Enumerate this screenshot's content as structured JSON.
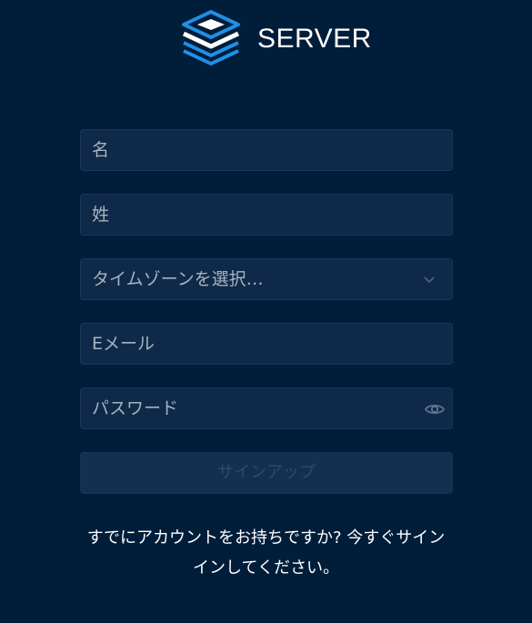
{
  "brand": {
    "name": "SERVER",
    "logo_icon": "layered-stack-icon",
    "logo_color": "#1e90e6"
  },
  "form": {
    "first_name_placeholder": "名",
    "last_name_placeholder": "姓",
    "timezone_selected": "タイムゾーンを選択…",
    "email_placeholder": "Eメール",
    "password_placeholder": "パスワード",
    "password_toggle_icon": "eye-icon",
    "timezone_dropdown_icon": "chevron-down-icon",
    "submit_label": "サインアップ"
  },
  "footer": {
    "signin_prompt": "すでにアカウントをお持ちですか? 今すぐサインインしてください。"
  },
  "colors": {
    "background": "#001d3a",
    "field_background": "#0f2a48",
    "field_border": "#1b3658",
    "disabled_button_text": "#2b4b6d"
  }
}
